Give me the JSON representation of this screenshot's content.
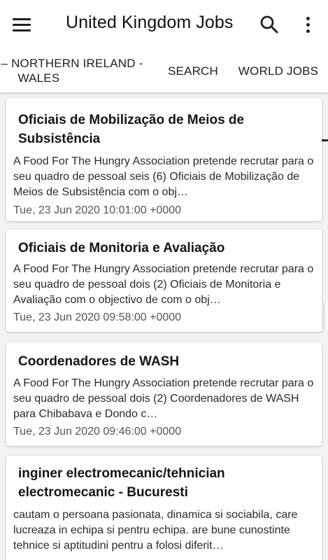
{
  "appbar": {
    "title": "United Kingdom Jobs",
    "menu_icon": "menu-icon",
    "search_icon": "search-icon",
    "more_icon": "more-vert-icon"
  },
  "tabs": [
    {
      "label_line1": "– NORTHERN IRELAND -",
      "label_line2": "WALES",
      "selected": false
    },
    {
      "label": "SEARCH",
      "selected": false
    },
    {
      "label": "WORLD JOBS",
      "selected": true
    }
  ],
  "jobs": [
    {
      "title": "Oficiais de Mobilização de Meios de Subsistência",
      "description": "A Food For The Hungry Association pretende recrutar para o seu quadro de pessoal seis (6) Oficiais de Mobilização de Meios de Subsistência com o obj…",
      "date": "Tue, 23 Jun 2020 10:01:00 +0000"
    },
    {
      "title": "Oficiais de Monitoria e Avaliação",
      "description": "A Food For The Hungry Association pretende recrutar para o seu quadro de pessoal dois (2) Oficiais de Monitoria e Avaliação com o objectivo de com o obj…",
      "date": "Tue, 23 Jun 2020 09:58:00 +0000"
    },
    {
      "title": "Coordenadores de WASH",
      "description": "A Food For The Hungry Association pretende recrutar para o seu quadro de pessoal dois (2) Coordenadores de WASH para Chibabava e Dondo c…",
      "date": "Tue, 23 Jun 2020 09:46:00 +0000"
    },
    {
      "title": "inginer electromecanic/tehnician electromecanic - Bucuresti",
      "description": "cautam o persoana pasionata, dinamica si sociabila, care lucreaza in echipa si pentru echipa. are bune cunostinte tehnice si aptitudini pentru a folosi diferit…",
      "date": ""
    }
  ]
}
